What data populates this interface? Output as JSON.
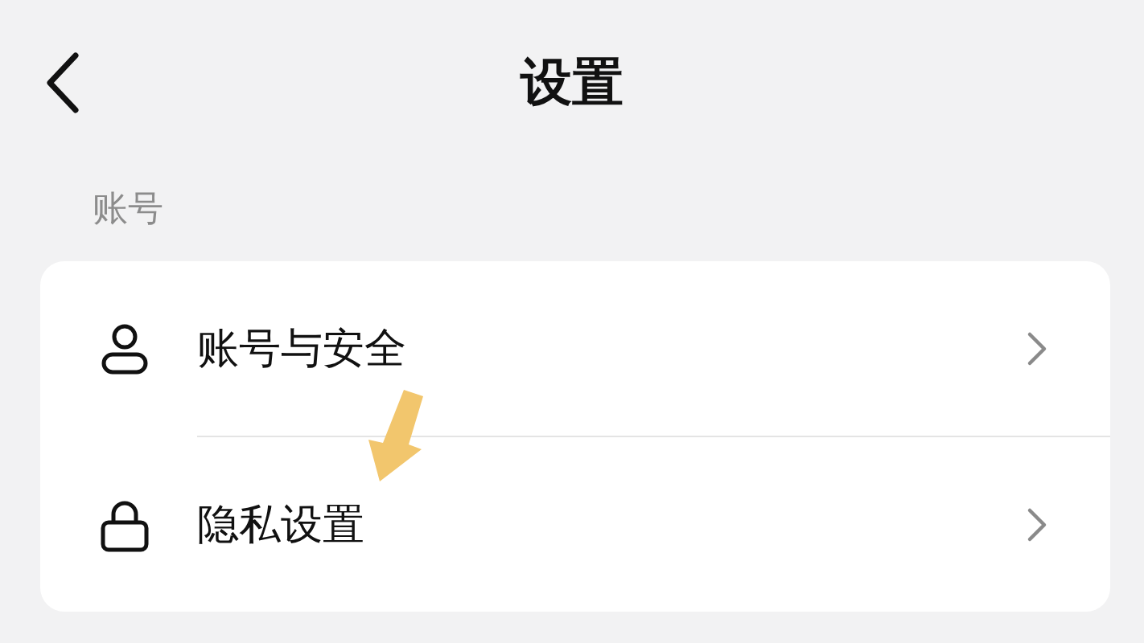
{
  "header": {
    "title": "设置"
  },
  "section": {
    "label": "账号"
  },
  "items": [
    {
      "kind": "person",
      "label": "账号与安全",
      "pointed": false
    },
    {
      "kind": "lock",
      "label": "隐私设置",
      "pointed": true
    }
  ]
}
